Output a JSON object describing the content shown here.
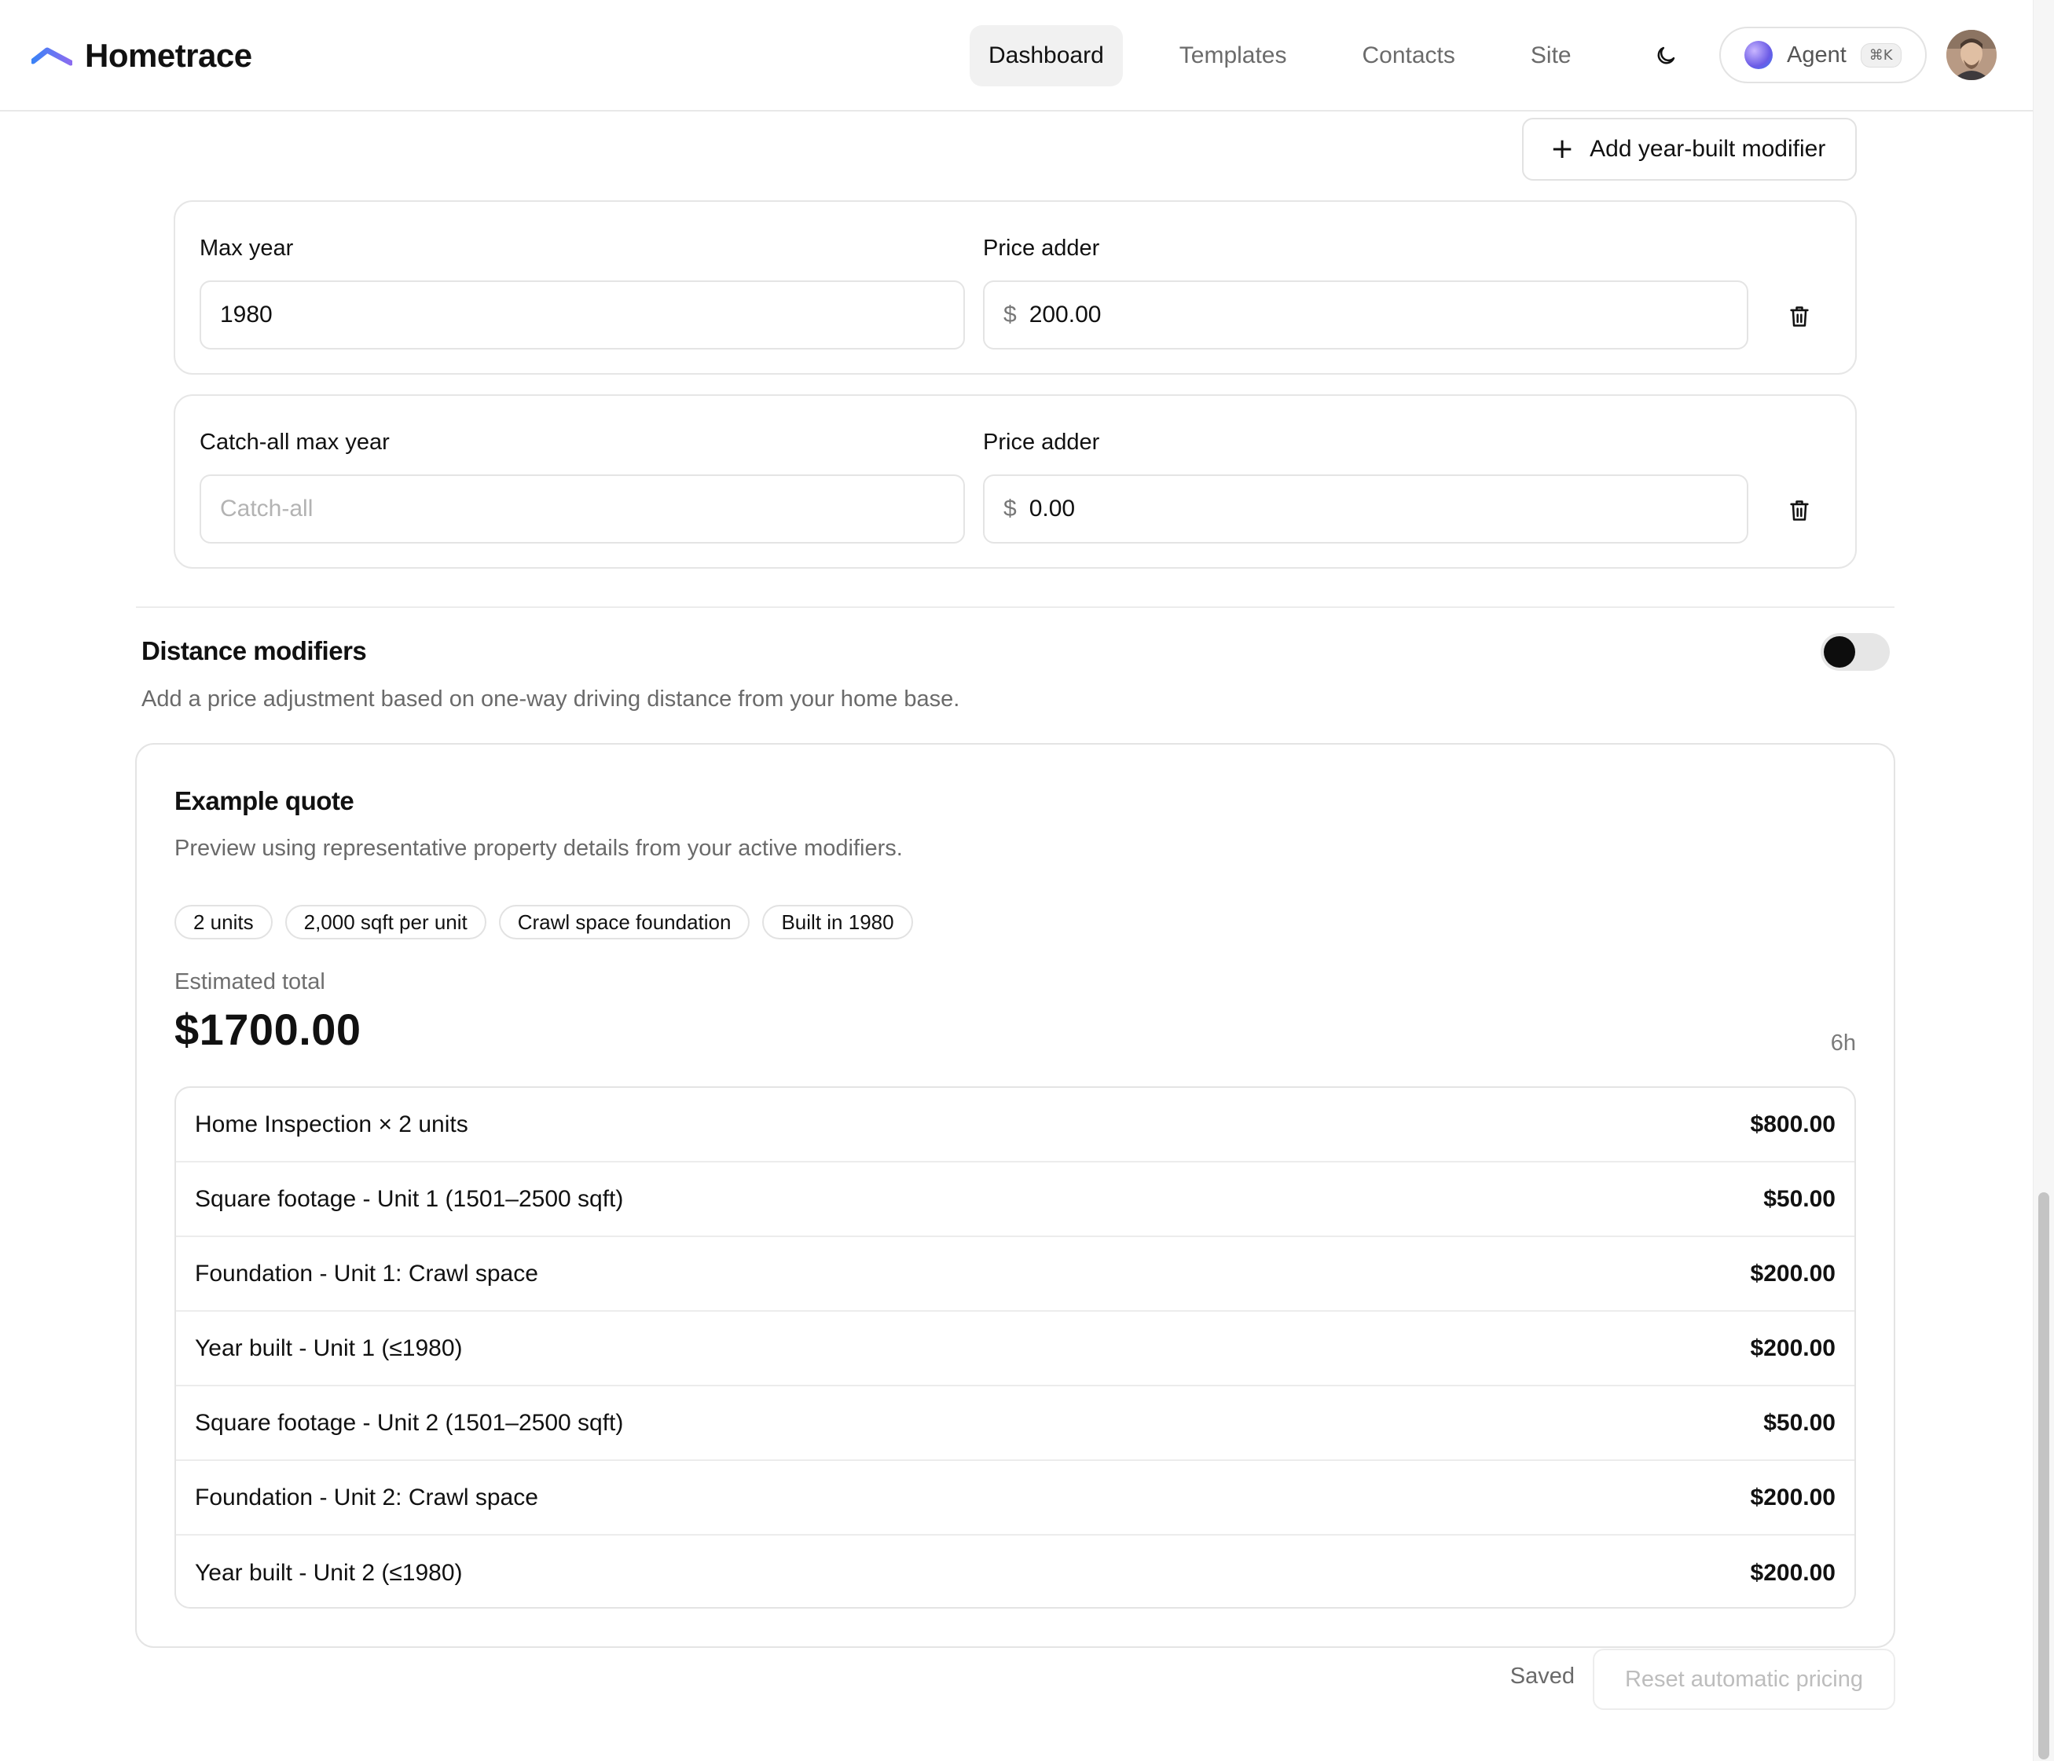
{
  "brand": {
    "name": "Hometrace"
  },
  "nav": {
    "items": [
      {
        "label": "Dashboard",
        "active": true
      },
      {
        "label": "Templates",
        "active": false
      },
      {
        "label": "Contacts",
        "active": false
      },
      {
        "label": "Site",
        "active": false
      }
    ],
    "theme_icon": "moon-icon",
    "agent": {
      "label": "Agent",
      "shortcut": "⌘K"
    }
  },
  "year_built": {
    "add_button_label": "Add year-built modifier",
    "modifiers": [
      {
        "year_label": "Max year",
        "year_value": "1980",
        "year_placeholder": "",
        "price_label": "Price adder",
        "currency": "$",
        "price_value": "200.00"
      },
      {
        "year_label": "Catch-all max year",
        "year_value": "",
        "year_placeholder": "Catch-all",
        "price_label": "Price adder",
        "currency": "$",
        "price_value": "0.00"
      }
    ]
  },
  "distance": {
    "title": "Distance modifiers",
    "description": "Add a price adjustment based on one-way driving distance from your home base.",
    "enabled": false
  },
  "quote": {
    "title": "Example quote",
    "description": "Preview using representative property details from your active modifiers.",
    "chips": [
      "2 units",
      "2,000 sqft per unit",
      "Crawl space foundation",
      "Built in 1980"
    ],
    "estimated_label": "Estimated total",
    "estimated_total": "$1700.00",
    "duration": "6h",
    "line_items": [
      {
        "label": "Home Inspection × 2 units",
        "amount": "$800.00"
      },
      {
        "label": "Square footage - Unit 1 (1501–2500 sqft)",
        "amount": "$50.00"
      },
      {
        "label": "Foundation - Unit 1: Crawl space",
        "amount": "$200.00"
      },
      {
        "label": "Year built - Unit 1 (≤1980)",
        "amount": "$200.00"
      },
      {
        "label": "Square footage - Unit 2 (1501–2500 sqft)",
        "amount": "$50.00"
      },
      {
        "label": "Foundation - Unit 2: Crawl space",
        "amount": "$200.00"
      },
      {
        "label": "Year built - Unit 2 (≤1980)",
        "amount": "$200.00"
      }
    ]
  },
  "footer": {
    "status": "Saved",
    "reset_label": "Reset automatic pricing"
  },
  "colors": {
    "accent_logo_start": "#7c6cf0",
    "accent_logo_end": "#3b82f6",
    "toggle_knob": "#0d0d0d",
    "muted_text": "#6a6a6a"
  }
}
